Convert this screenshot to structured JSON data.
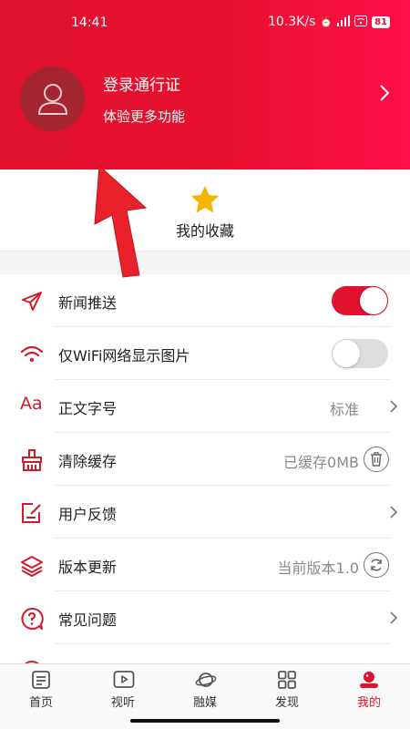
{
  "status_bar": {
    "time": "14:41",
    "speed": "10.3K/s",
    "battery": "81"
  },
  "header": {
    "title": "登录通行证",
    "subtitle": "体验更多功能"
  },
  "favorites": {
    "label": "我的收藏"
  },
  "settings": [
    {
      "label": "新闻推送",
      "toggle": "on"
    },
    {
      "label": "仅WiFi网络显示图片",
      "toggle": "off"
    },
    {
      "label": "正文字号",
      "value": "标准"
    },
    {
      "label": "清除缓存",
      "value": "已缓存0MB"
    },
    {
      "label": "用户反馈"
    },
    {
      "label": "版本更新",
      "value": "当前版本1.0"
    },
    {
      "label": "常见问题"
    }
  ],
  "tabs": [
    {
      "label": "首页",
      "icon": "home-icon"
    },
    {
      "label": "视听",
      "icon": "play-icon"
    },
    {
      "label": "融媒",
      "icon": "planet-icon"
    },
    {
      "label": "发现",
      "icon": "grid-icon"
    },
    {
      "label": "我的",
      "icon": "profile-icon",
      "active": true
    }
  ],
  "colors": {
    "accent": "#e0122f",
    "header_start": "#e0122f",
    "header_end": "#ff0f47",
    "toggle_off": "#dedede"
  }
}
